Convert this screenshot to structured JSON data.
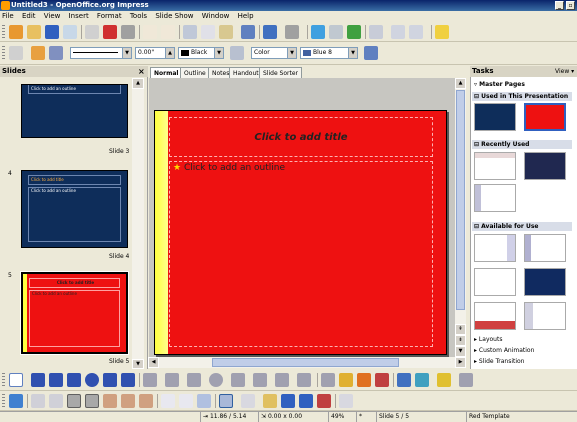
{
  "window": {
    "title": "Untitled3 - OpenOffice.org Impress",
    "minimize": "_",
    "maximize": "▫"
  },
  "menu": [
    "File",
    "Edit",
    "View",
    "Insert",
    "Format",
    "Tools",
    "Slide Show",
    "Window",
    "Help"
  ],
  "line_toolbar": {
    "line_width": "0.00\"",
    "line_color": "Black",
    "area_style": "Color",
    "area_color": "Blue 8"
  },
  "slides_pane": {
    "title": "Slides",
    "close": "×",
    "items": [
      {
        "num": "",
        "label": "Slide 3",
        "title_text": "",
        "outline_text": "Click to add an outline"
      },
      {
        "num": "4",
        "label": "Slide 4",
        "title_text": "Click to add title",
        "outline_text": "Click to add an outline"
      },
      {
        "num": "5",
        "label": "Slide 5",
        "title_text": "Click to add title",
        "outline_text": "Click to add an outline"
      }
    ]
  },
  "view_tabs": [
    "Normal",
    "Outline",
    "Notes",
    "Handout",
    "Slide Sorter"
  ],
  "slide": {
    "title_placeholder": "Click to add title",
    "outline_placeholder": "Click to add an outline",
    "bullet": "★"
  },
  "tasks": {
    "title": "Tasks",
    "view": "View ▾",
    "master_pages": "Master Pages",
    "used": "Used in This Presentation",
    "recent": "Recently Used",
    "available": "Available for Use",
    "bottom_sections": [
      "Layouts",
      "Custom Animation",
      "Slide Transition"
    ]
  },
  "status": {
    "position": "11.86 / 5.14",
    "size": "0.00 x 0.00",
    "zoom": "49%",
    "modified": "*",
    "slide": "Slide 5 / 5",
    "template": "Red Template"
  },
  "colors": {
    "slide_bg": "#ee1111",
    "blue_slide": "#0e2d5a",
    "accent_yellow": "#ffff40"
  }
}
